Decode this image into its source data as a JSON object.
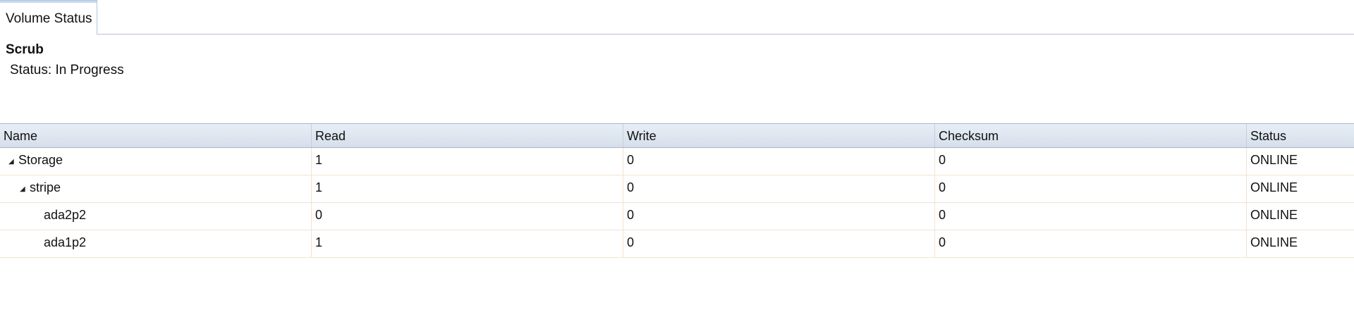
{
  "tabs": [
    {
      "label": "Volume Status"
    }
  ],
  "scrub": {
    "title": "Scrub",
    "status_label": "Status:",
    "status_value": "In Progress"
  },
  "table": {
    "columns": [
      "Name",
      "Read",
      "Write",
      "Checksum",
      "Status"
    ],
    "rows": [
      {
        "name": "Storage",
        "read": "1",
        "write": "0",
        "checksum": "0",
        "status": "ONLINE",
        "expander": "◢"
      },
      {
        "name": "stripe",
        "read": "1",
        "write": "0",
        "checksum": "0",
        "status": "ONLINE",
        "expander": "◢"
      },
      {
        "name": "ada2p2",
        "read": "0",
        "write": "0",
        "checksum": "0",
        "status": "ONLINE"
      },
      {
        "name": "ada1p2",
        "read": "1",
        "write": "0",
        "checksum": "0",
        "status": "ONLINE"
      }
    ]
  }
}
